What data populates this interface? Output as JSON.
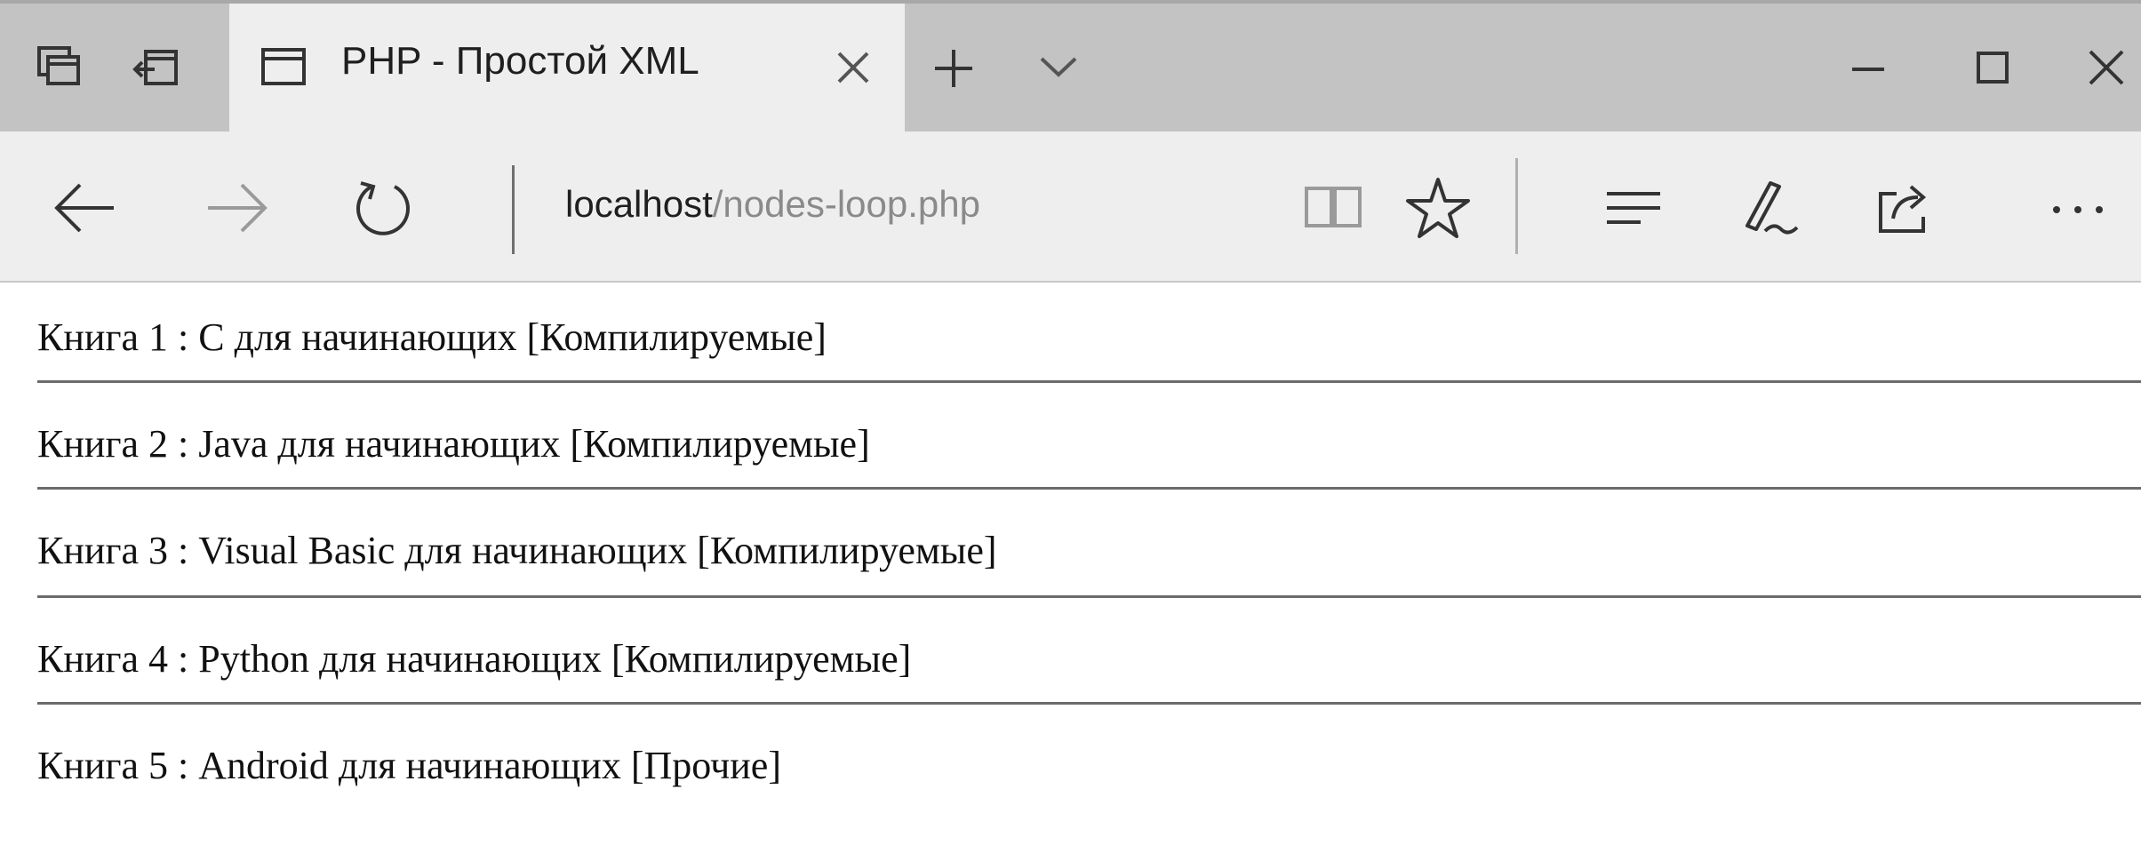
{
  "browser": {
    "tab": {
      "title": "PHP - Простой XML"
    },
    "address": {
      "host": "localhost",
      "path": "/nodes-loop.php"
    },
    "icons": {
      "tab_actions": [
        "set-aside-tabs-icon",
        "restore-tabs-icon"
      ],
      "tab": [
        "page-favicon-icon",
        "close-icon"
      ],
      "tab_strip": [
        "new-tab-icon",
        "tab-list-chevron-icon"
      ],
      "window": [
        "minimize-icon",
        "maximize-icon",
        "close-window-icon"
      ],
      "navigation": [
        "back-arrow-icon",
        "forward-arrow-icon",
        "refresh-icon"
      ],
      "address_bar": [
        "reading-view-icon",
        "favorite-star-icon"
      ],
      "toolbar": [
        "hub-icon",
        "web-note-icon",
        "share-icon",
        "more-icon"
      ]
    }
  },
  "page": {
    "books": [
      "Книга 1 : C для начинающих [Компилируемые]",
      "Книга 2 : Java для начинающих [Компилируемые]",
      "Книга 3 : Visual Basic для начинающих [Компилируемые]",
      "Книга 4 : Python для начинающих [Компилируемые]",
      "Книга 5 : Android для начинающих [Прочие]"
    ]
  }
}
